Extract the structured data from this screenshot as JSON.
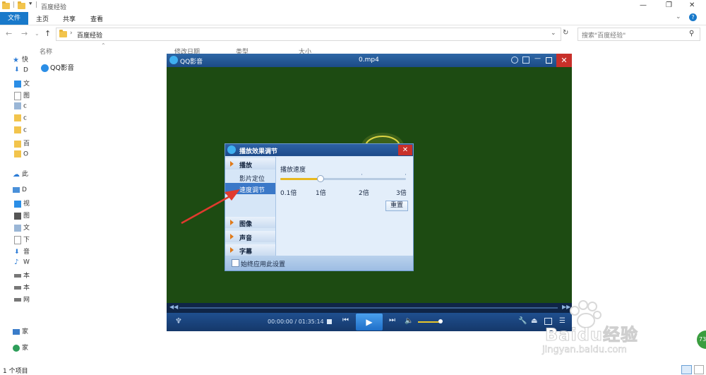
{
  "explorer": {
    "window_title": "百度经验",
    "ribbon_tabs": [
      "文件",
      "主页",
      "共享",
      "查看"
    ],
    "address_path": "百度经验",
    "search_placeholder": "搜索\"百度经验\"",
    "columns": [
      "名称",
      "修改日期",
      "类型",
      "大小"
    ],
    "file_item": "QQ影音",
    "nav_items": [
      "快",
      "D",
      "文",
      "图",
      "c",
      "c",
      "c",
      "百",
      "O",
      "此",
      "D",
      "视",
      "图",
      "文",
      "下",
      "音",
      "W",
      "本",
      "本",
      "网",
      "家"
    ],
    "status": "1 个项目"
  },
  "player": {
    "app_name": "QQ影音",
    "file_name": "0.mp4",
    "time_current": "00:00:00",
    "time_total": "01:35:14",
    "time_display": "00:00:00 / 01:35:14",
    "volume_fraction": 0.85
  },
  "dialog": {
    "title": "播放效果调节",
    "sections": [
      "播放",
      "图像",
      "声音",
      "字幕"
    ],
    "play_items": [
      "影片定位",
      "速度调节"
    ],
    "selected_item": "速度调节",
    "speed_label": "播放速度",
    "speed_marks": [
      "0.1倍",
      "1倍",
      "2倍",
      "3倍"
    ],
    "speed_value": "1倍",
    "reset_label": "重置",
    "always_apply_label": "始终应用此设置",
    "always_apply_checked": false
  },
  "watermark": {
    "brand": "Baidu经验",
    "url": "jingyan.baidu.com",
    "badge": "73"
  },
  "colors": {
    "explorer_accent": "#1979ca",
    "player_bar": "#1c4b86",
    "video_bg": "#1d4b12",
    "close_red": "#c8302a",
    "annotation_arrow": "#e03a2e"
  }
}
